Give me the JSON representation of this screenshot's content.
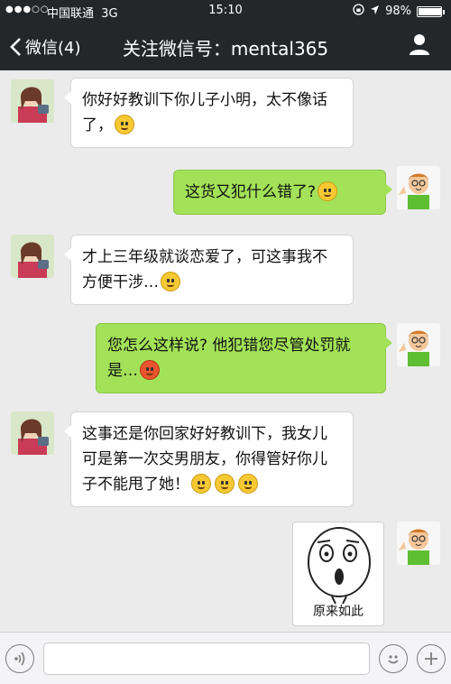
{
  "status": {
    "signal": "●●●○○",
    "carrier": "中国联通",
    "network": "3G",
    "time": "15:10",
    "battery": "98%",
    "battery_level": 0.98
  },
  "nav": {
    "back_label": "微信(4)",
    "title": "关注微信号：mental365"
  },
  "messages": [
    {
      "side": "left",
      "text": "你好好教训下你儿子小明，太不像话了，",
      "emoji_count": 1
    },
    {
      "side": "right",
      "text": "这货又犯什么错了?",
      "emoji_count": 1
    },
    {
      "side": "left",
      "text": "才上三年级就谈恋爱了，可这事我不方便干涉…",
      "emoji_count": 1
    },
    {
      "side": "right",
      "text": "您怎么这样说? 他犯错您尽管处罚就是…",
      "emoji_count": 1
    },
    {
      "side": "left",
      "text": "这事还是你回家好好教训下，我女儿可是第一次交男朋友，你得管好你儿子不能甩了她！",
      "emoji_count": 3
    },
    {
      "side": "right",
      "sticker_caption": "原来如此"
    }
  ],
  "colors": {
    "bar": "#23272a",
    "chat_bg": "#ebebeb",
    "bubble_right": "#a3e258",
    "bubble_left": "#ffffff"
  }
}
